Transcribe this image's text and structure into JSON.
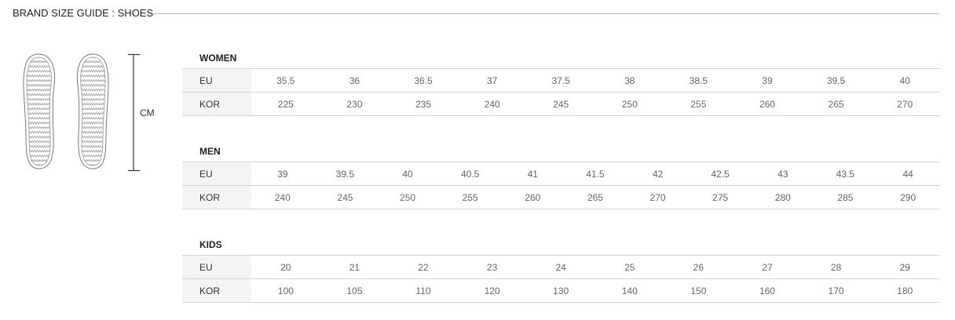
{
  "header": {
    "title": "BRAND SIZE GUIDE : SHOES"
  },
  "illustration": {
    "measure_label": "CM",
    "icon": "shoe-sole-outline-icon"
  },
  "colors": {
    "rule": "#b9b9b9",
    "row_border": "#d3d3d3",
    "label_bg": "#f4f4f4",
    "value_text": "#666666"
  },
  "sections": [
    {
      "title": "WOMEN",
      "rows": [
        {
          "label": "EU",
          "values": [
            "35.5",
            "36",
            "36.5",
            "37",
            "37.5",
            "38",
            "38.5",
            "39",
            "39.5",
            "40"
          ]
        },
        {
          "label": "KOR",
          "values": [
            "225",
            "230",
            "235",
            "240",
            "245",
            "250",
            "255",
            "260",
            "265",
            "270"
          ]
        }
      ]
    },
    {
      "title": "MEN",
      "rows": [
        {
          "label": "EU",
          "values": [
            "39",
            "39.5",
            "40",
            "40.5",
            "41",
            "41.5",
            "42",
            "42.5",
            "43",
            "43.5",
            "44"
          ]
        },
        {
          "label": "KOR",
          "values": [
            "240",
            "245",
            "250",
            "255",
            "260",
            "265",
            "270",
            "275",
            "280",
            "285",
            "290"
          ]
        }
      ]
    },
    {
      "title": "KIDS",
      "rows": [
        {
          "label": "EU",
          "values": [
            "20",
            "21",
            "22",
            "23",
            "24",
            "25",
            "26",
            "27",
            "28",
            "29"
          ]
        },
        {
          "label": "KOR",
          "values": [
            "100",
            "105",
            "110",
            "120",
            "130",
            "140",
            "150",
            "160",
            "170",
            "180"
          ]
        }
      ]
    }
  ]
}
